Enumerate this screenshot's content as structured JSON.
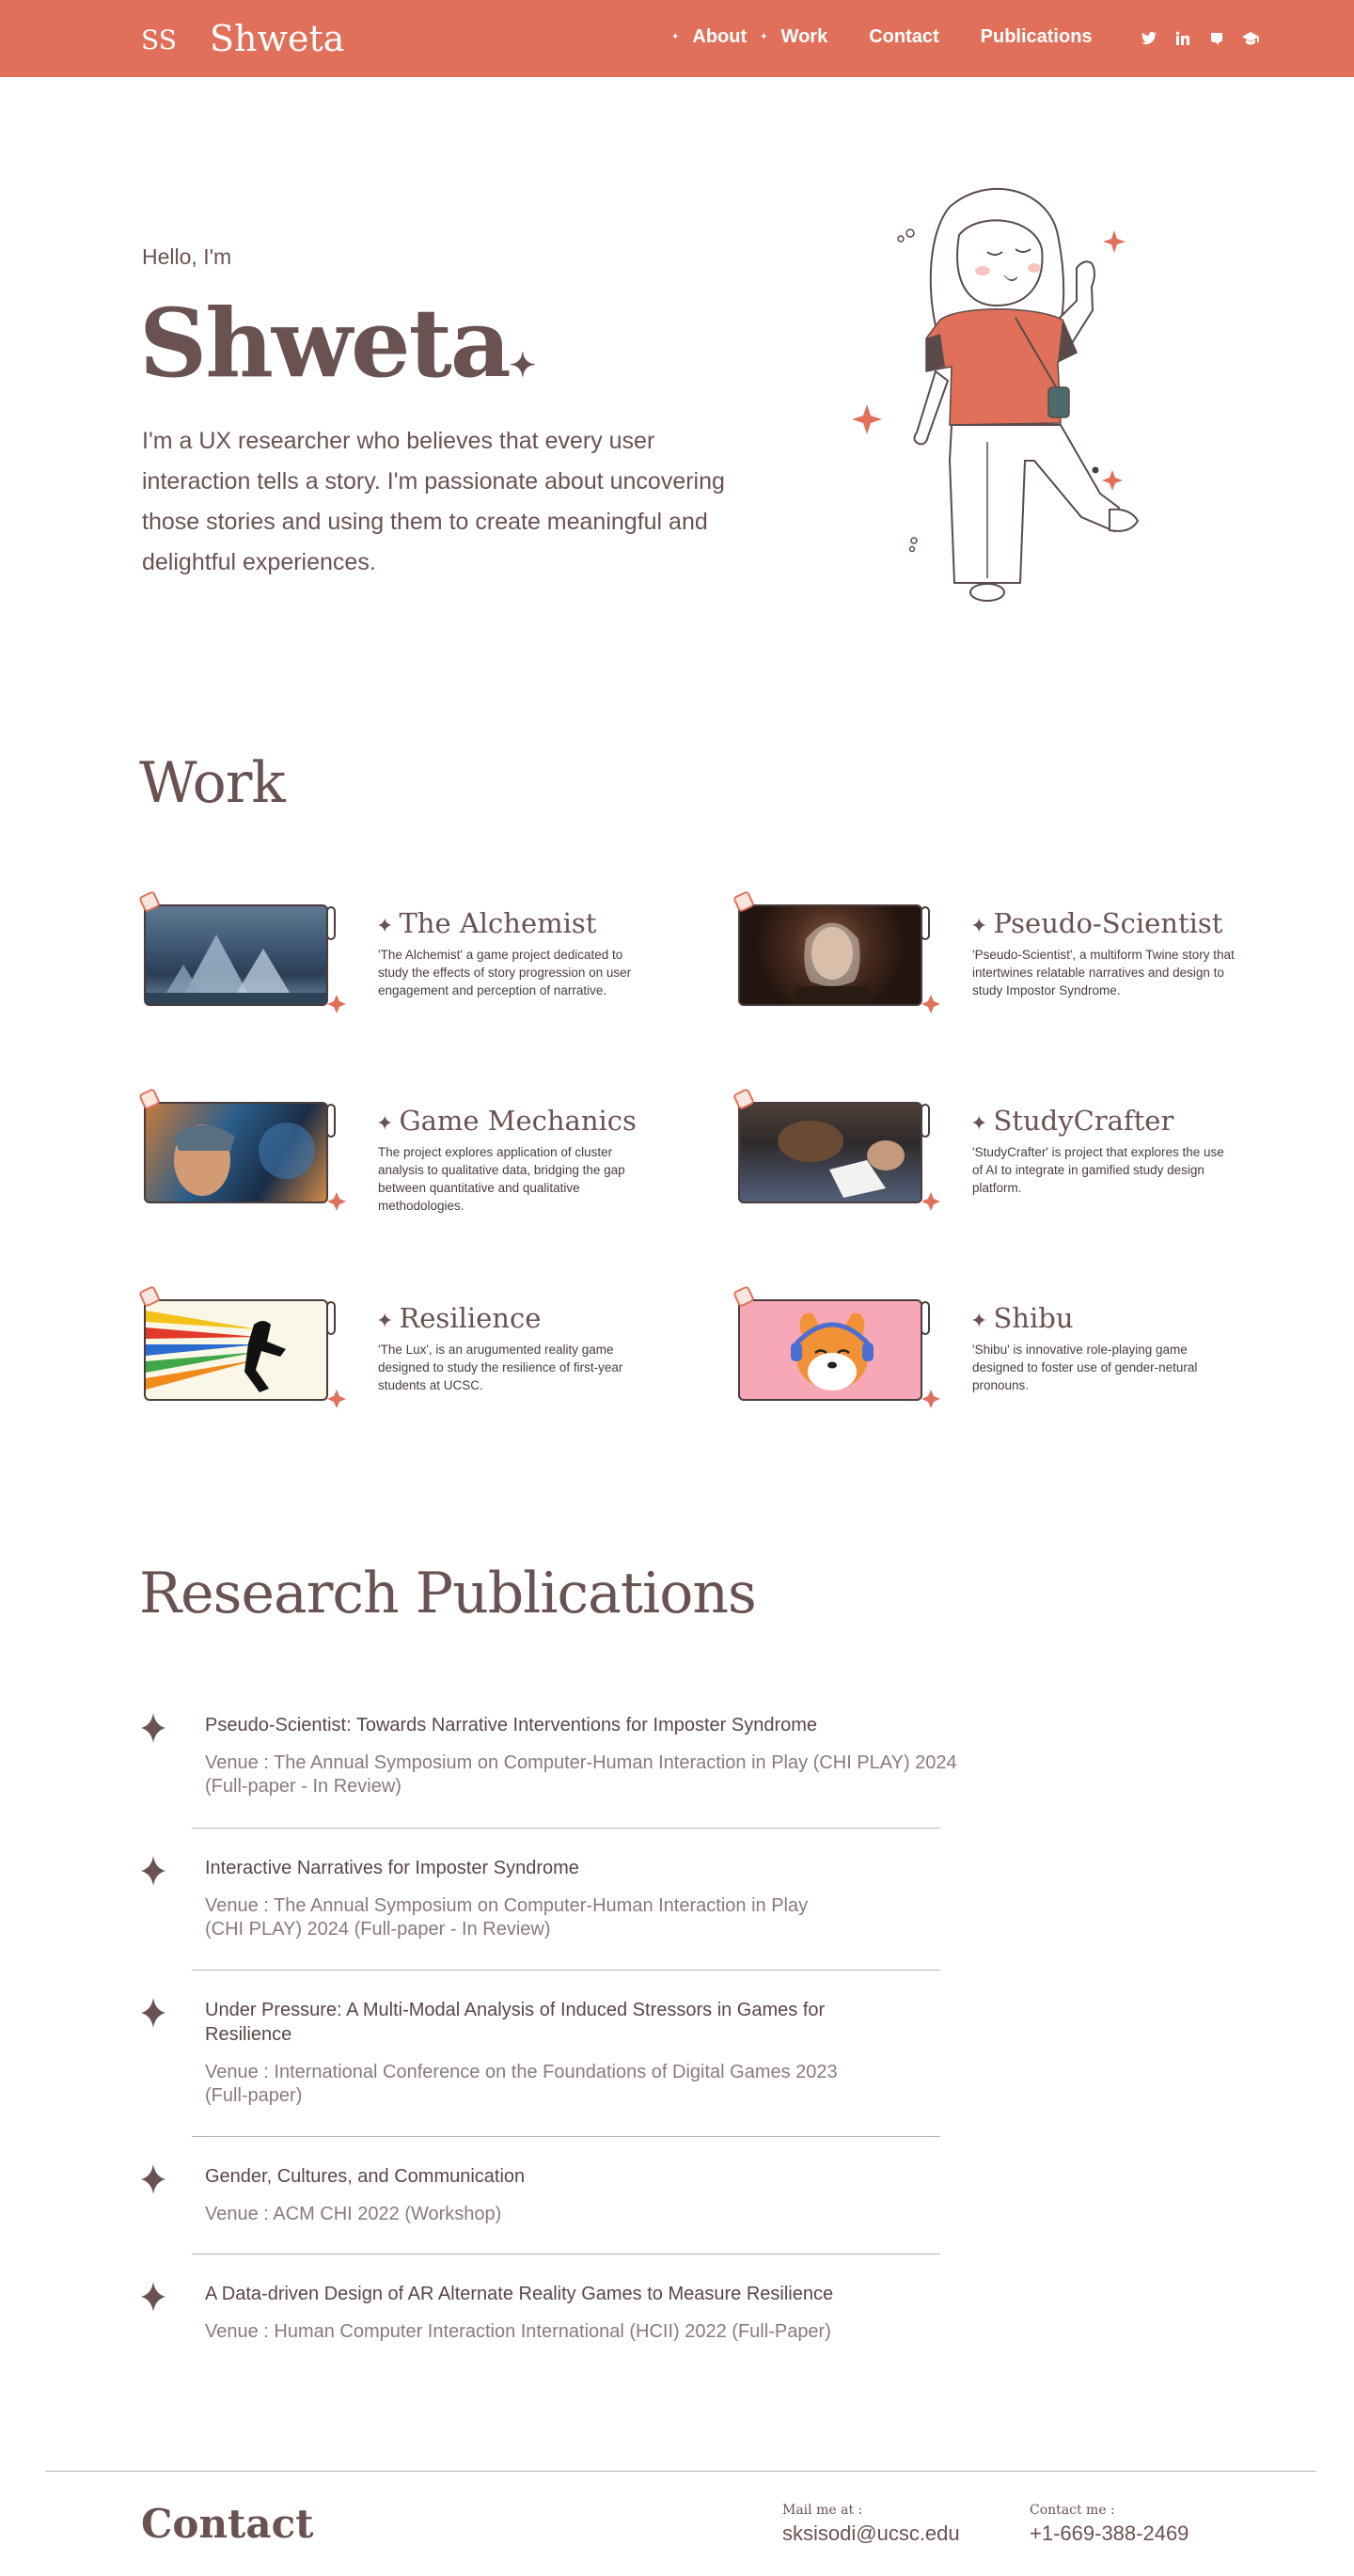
{
  "nav": {
    "logo_mark": "SS",
    "logo_text": "Shweta",
    "links": [
      "About",
      "Work",
      "Contact",
      "Publications"
    ],
    "socials": [
      "twitter-icon",
      "linkedin-icon",
      "medium-icon",
      "graduation-cap-icon"
    ]
  },
  "hero": {
    "greeting": "Hello, I'm",
    "name": "Shweta",
    "description": "I'm a UX researcher who believes that every user interaction tells a story. I'm passionate about uncovering those stories and using them to create meaningful and delightful experiences."
  },
  "work": {
    "title": "Work",
    "projects": [
      {
        "title": "The Alchemist",
        "description": "'The Alchemist' a game project dedicated to study the effects of story progression on user engagement and perception of narrative."
      },
      {
        "title": "Pseudo-Scientist",
        "description": "'Pseudo-Scientist', a multiform Twine story that intertwines relatable narratives and design to study Impostor Syndrome."
      },
      {
        "title": "Game Mechanics",
        "description": "The project explores application of cluster analysis to qualitative data, bridging the gap between quantitative and qualitative methodologies."
      },
      {
        "title": "StudyCrafter",
        "description": "'StudyCrafter' is project that explores the use of AI to integrate in gamified study design platform."
      },
      {
        "title": "Resilience",
        "description": "'The Lux', is an arugumented reality game designed to study the resilience of first-year students at UCSC."
      },
      {
        "title": "Shibu",
        "description": "'Shibu' is innovative role-playing game designed to foster use of gender-netural pronouns."
      }
    ]
  },
  "publications": {
    "title": "Research Publications",
    "items": [
      {
        "title": "Pseudo-Scientist: Towards Narrative Interventions for Imposter Syndrome",
        "venue_lines": [
          "Venue : The Annual Symposium on Computer-Human Interaction in Play (CHI PLAY) 2024",
          "(Full-paper - In Review)"
        ]
      },
      {
        "title": "Interactive Narratives for Imposter Syndrome",
        "venue_lines": [
          "Venue : The Annual Symposium on Computer-Human Interaction in Play",
          "(CHI PLAY) 2024 (Full-paper - In Review)"
        ]
      },
      {
        "title": "Under Pressure: A Multi-Modal Analysis of Induced Stressors in Games for Resilience",
        "venue_lines": [
          "Venue : International Conference on the Foundations of Digital Games 2023",
          "(Full-paper)"
        ]
      },
      {
        "title": "Gender, Cultures, and Communication",
        "venue_lines": [
          "Venue : ACM CHI 2022 (Workshop)"
        ]
      },
      {
        "title": "A Data-driven Design of AR Alternate Reality Games to Measure Resilience",
        "venue_lines": [
          "Venue : Human Computer Interaction International (HCII) 2022 (Full-Paper)"
        ]
      }
    ]
  },
  "contact": {
    "title": "Contact",
    "mail_label": "Mail me at :",
    "mail": "sksisodi@ucsc.edu",
    "phone_label": "Contact me :",
    "phone": "+1-669-388-2469"
  },
  "colors": {
    "accent": "#e1705a",
    "text": "#6b5252"
  }
}
